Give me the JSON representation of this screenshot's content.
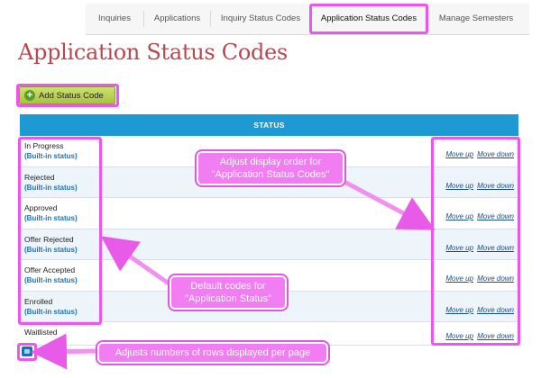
{
  "tabs": [
    {
      "label": "Inquiries",
      "active": false
    },
    {
      "label": "Applications",
      "active": false
    },
    {
      "label": "Inquiry Status Codes",
      "active": false
    },
    {
      "label": "Application Status Codes",
      "active": true
    },
    {
      "label": "Manage Semesters",
      "active": false
    }
  ],
  "page_title": "Application Status Codes",
  "add_button_label": "Add Status Code",
  "table": {
    "header": "STATUS",
    "rows": [
      {
        "name": "In Progress",
        "note": "(Built-in status)"
      },
      {
        "name": "Rejected",
        "note": "(Built-in status)"
      },
      {
        "name": "Approved",
        "note": "(Built-in status)"
      },
      {
        "name": "Offer Rejected",
        "note": "(Built-in status)"
      },
      {
        "name": "Offer Accepted",
        "note": "(Built-in status)"
      },
      {
        "name": "Enrolled",
        "note": "(Built-in status)"
      },
      {
        "name": "Waitlisted",
        "note": ""
      }
    ],
    "move_up_label": "Move up",
    "move_down_label": "Move down"
  },
  "callouts": {
    "order": "Adjust display order for \"Application Status Codes\"",
    "defaults": "Default codes for \"Application Status\"",
    "rows": "Adjusts numbers of rows displayed per page"
  },
  "colors": {
    "title": "#b8484e",
    "table_header": "#1d9ad4",
    "callout": "#f27cf2",
    "highlight": "#ee55ee",
    "add_button": "#b8d04a"
  },
  "icons": {
    "add_button": "plus-circle-icon",
    "pager": "rows-per-page-icon"
  }
}
